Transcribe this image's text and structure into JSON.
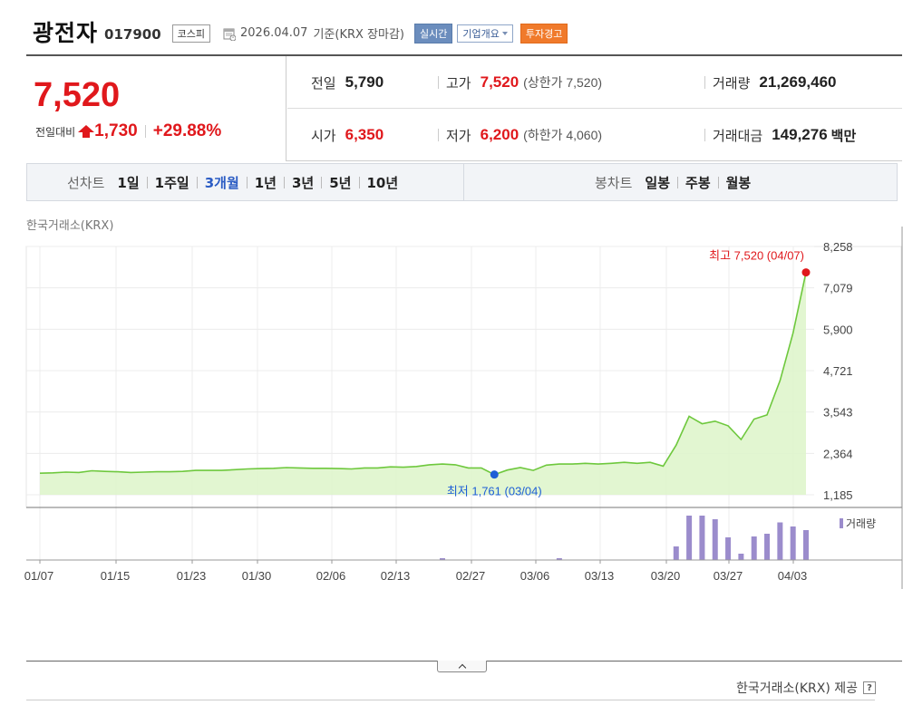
{
  "header": {
    "stock_name": "광전자",
    "stock_code": "017900",
    "market": "코스피",
    "date": "2026.04.07",
    "date_note": "기준(KRX 장마감)",
    "realtime_label": "실시간",
    "company_label": "기업개요",
    "warning_label": "투자경고"
  },
  "quote": {
    "current_price": "7,520",
    "change_label": "전일대비",
    "change_amount": "1,730",
    "change_pct": "+29.88%",
    "prev_close_label": "전일",
    "prev_close": "5,790",
    "high_label": "고가",
    "high": "7,520",
    "upper_limit": "(상한가 7,520)",
    "volume_label": "거래량",
    "volume": "21,269,460",
    "open_label": "시가",
    "open": "6,350",
    "low_label": "저가",
    "low": "6,200",
    "lower_limit": "(하한가 4,060)",
    "trade_value_label": "거래대금",
    "trade_value": "149,276",
    "trade_value_unit": "백만",
    "colors": {
      "up": "#e0181c",
      "active_tab": "#2b5cc4"
    }
  },
  "tabs": {
    "line_title": "선차트",
    "line_tabs": [
      "1일",
      "1주일",
      "3개월",
      "1년",
      "3년",
      "5년",
      "10년"
    ],
    "active_index": 2,
    "candle_title": "봉차트",
    "candle_tabs": [
      "일봉",
      "주봉",
      "월봉"
    ]
  },
  "chart_data": {
    "type": "area",
    "source_label": "한국거래소(KRX)",
    "y_ticks": [
      "8,258",
      "7,079",
      "5,900",
      "4,721",
      "3,543",
      "2,364",
      "1,185"
    ],
    "ylim": [
      1185,
      8258
    ],
    "x_tick_labels": [
      "01/07",
      "01/15",
      "01/23",
      "01/30",
      "02/06",
      "02/13",
      "02/27",
      "03/06",
      "03/13",
      "03/20",
      "03/27",
      "04/03"
    ],
    "price": [
      1800,
      1810,
      1830,
      1820,
      1870,
      1850,
      1840,
      1820,
      1830,
      1840,
      1840,
      1850,
      1880,
      1880,
      1880,
      1900,
      1920,
      1930,
      1940,
      1960,
      1950,
      1940,
      1940,
      1930,
      1920,
      1950,
      1950,
      1980,
      1970,
      1990,
      2040,
      2060,
      2040,
      1950,
      1950,
      1761,
      1890,
      1960,
      1880,
      2030,
      2060,
      2060,
      2080,
      2060,
      2080,
      2110,
      2080,
      2110,
      2000,
      2600,
      3420,
      3210,
      3280,
      3150,
      2760,
      3340,
      3460,
      4440,
      5790,
      7520
    ],
    "volume_series_label": "거래량",
    "volume": [
      0,
      0,
      0,
      0,
      0,
      0,
      0,
      0,
      0,
      0,
      0,
      0,
      0,
      0,
      0,
      0,
      0,
      0,
      0,
      0,
      0,
      0,
      0,
      0,
      0,
      0,
      0,
      0,
      0,
      0,
      0,
      0.04,
      0,
      0,
      0,
      0,
      0,
      0,
      0,
      0,
      0.04,
      0,
      0,
      0,
      0,
      0,
      0,
      0,
      0,
      0.3,
      0.98,
      0.98,
      0.9,
      0.5,
      0.14,
      0.52,
      0.58,
      0.83,
      0.74,
      0.66
    ],
    "max_annotation": "최고 7,520 (04/07)",
    "min_annotation": "최저 1,761 (03/04)",
    "colors": {
      "line": "#6ec83d",
      "fill": "#dff5cc",
      "volume": "#9b8ccc",
      "max_dot": "#e0181c",
      "min_dot": "#1e5fd6"
    }
  },
  "footer": {
    "provider": "한국거래소(KRX) 제공",
    "help": "?"
  }
}
